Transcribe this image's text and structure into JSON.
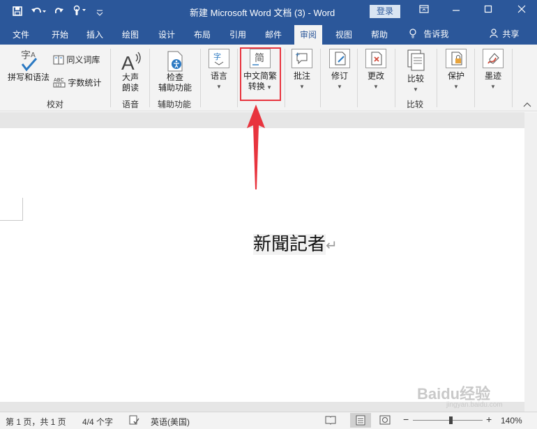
{
  "app": {
    "title": "新建 Microsoft Word 文档 (3)  -  Word",
    "login_label": "登录"
  },
  "quick_access": {
    "icons": [
      "save-icon",
      "undo-icon",
      "redo-icon",
      "touch-icon",
      "customize-icon"
    ]
  },
  "tabs": [
    {
      "label": "文件"
    },
    {
      "label": "开始"
    },
    {
      "label": "插入"
    },
    {
      "label": "绘图"
    },
    {
      "label": "设计"
    },
    {
      "label": "布局"
    },
    {
      "label": "引用"
    },
    {
      "label": "邮件"
    },
    {
      "label": "审阅",
      "active": true
    },
    {
      "label": "视图"
    },
    {
      "label": "帮助"
    }
  ],
  "tell_me": "告诉我",
  "share": "共享",
  "ribbon": {
    "proofing": {
      "spelling": "拼写和语法",
      "thesaurus": "同义词库",
      "word_count": "字数统计",
      "group": "校对"
    },
    "speech": {
      "read_aloud_1": "大声",
      "read_aloud_2": "朗读",
      "group": "语音"
    },
    "accessibility": {
      "check_1": "检查",
      "check_2": "辅助功能",
      "group": "辅助功能"
    },
    "language": {
      "label": "语言"
    },
    "chinese_conversion": {
      "icon_text": "简",
      "label_1": "中文简繁",
      "label_2": "转换"
    },
    "comments": {
      "label": "批注"
    },
    "tracking": {
      "label": "修订"
    },
    "changes": {
      "label": "更改"
    },
    "compare": {
      "label": "比较",
      "group": "比较"
    },
    "protect": {
      "label": "保护"
    },
    "ink": {
      "label": "墨迹"
    }
  },
  "document": {
    "text": "新聞記者",
    "paragraph_mark": "↵"
  },
  "status_bar": {
    "page": "第 1 页，共 1 页",
    "words": "4/4 个字",
    "language": "英语(美国)",
    "zoom": "140%",
    "zoom_level": 1.4,
    "minus": "−",
    "plus": "+"
  },
  "watermark": {
    "text": "Baidu经验",
    "url": "jingyan.baidu.com"
  },
  "colors": {
    "word_blue": "#2b579a",
    "ribbon_bg": "#f3f3f3",
    "highlight_red": "#e8343e"
  }
}
